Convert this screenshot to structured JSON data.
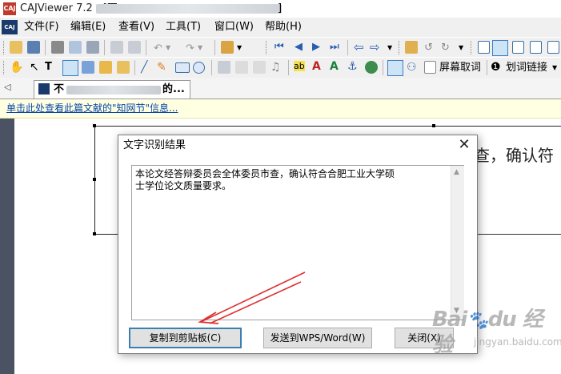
{
  "window": {
    "title_visible": "CAJViewer 7.2 - [不",
    "title_suffix": "]"
  },
  "menu": {
    "logo": "CAJ",
    "items": [
      "文件(F)",
      "编辑(E)",
      "查看(V)",
      "工具(T)",
      "窗口(W)",
      "帮助(H)"
    ]
  },
  "toolbar2": {
    "screen_lookup_label": "屏幕取词",
    "word_link_label": "划词链接"
  },
  "tabs": {
    "doc_tab_prefix": "不",
    "doc_tab_suffix": "的..."
  },
  "infobar": {
    "link_text": "单击此处查看此篇文献的\"知网节\"信息..."
  },
  "document": {
    "visible_text": "查，确认符"
  },
  "dialog": {
    "title": "文字识别结果",
    "close_glyph": "✕",
    "result_text": "本论文经答辩委员会全体委员市查，确认符合合肥工业大学硕\n士学位论文质量要求。",
    "buttons": {
      "copy": "复制到剪贴板(C)",
      "send": "发送到WPS/Word(W)",
      "close": "关闭(X)"
    }
  },
  "watermark": {
    "logo_text": "Bai du 经验",
    "url": "jingyan.baidu.com"
  },
  "colors": {
    "annotation_arrow": "#e03030",
    "link": "#0645ad",
    "infobar_bg": "#ffffe1",
    "rail": "#4a5263"
  }
}
